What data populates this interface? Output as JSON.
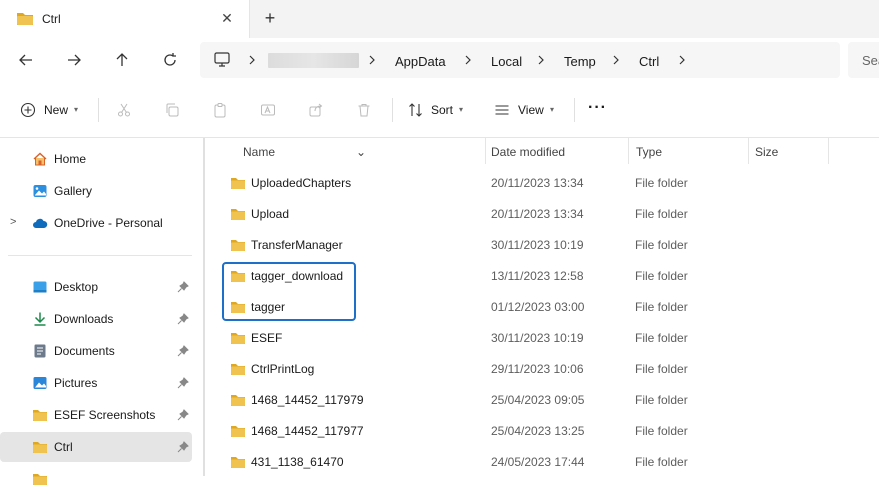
{
  "tab": {
    "title": "Ctrl",
    "close": "✕",
    "new_tab": "+"
  },
  "address": {
    "crumbs": [
      "AppData",
      "Local",
      "Temp",
      "Ctrl"
    ],
    "search_placeholder": "Sea"
  },
  "toolbar": {
    "new_label": "New",
    "sort_label": "Sort",
    "view_label": "View",
    "more_label": "···"
  },
  "sidebar": {
    "top_items": [
      {
        "label": "Home",
        "icon": "home-icon"
      },
      {
        "label": "Gallery",
        "icon": "gallery-icon"
      },
      {
        "label": "OneDrive - Personal",
        "icon": "cloud-icon"
      }
    ],
    "quick_access": [
      {
        "label": "Desktop",
        "icon": "desktop-icon"
      },
      {
        "label": "Downloads",
        "icon": "download-icon"
      },
      {
        "label": "Documents",
        "icon": "documents-icon"
      },
      {
        "label": "Pictures",
        "icon": "pictures-icon"
      },
      {
        "label": "ESEF Screenshots",
        "icon": "folder-icon"
      },
      {
        "label": "Ctrl",
        "icon": "folder-icon"
      }
    ]
  },
  "columns": {
    "name": "Name",
    "date": "Date modified",
    "type": "Type",
    "size": "Size"
  },
  "files": [
    {
      "name": "UploadedChapters",
      "date": "20/11/2023 13:34",
      "type": "File folder"
    },
    {
      "name": "Upload",
      "date": "20/11/2023 13:34",
      "type": "File folder"
    },
    {
      "name": "TransferManager",
      "date": "30/11/2023 10:19",
      "type": "File folder"
    },
    {
      "name": "tagger_download",
      "date": "13/11/2023 12:58",
      "type": "File folder"
    },
    {
      "name": "tagger",
      "date": "01/12/2023 03:00",
      "type": "File folder"
    },
    {
      "name": "ESEF",
      "date": "30/11/2023 10:19",
      "type": "File folder"
    },
    {
      "name": "CtrlPrintLog",
      "date": "29/11/2023 10:06",
      "type": "File folder"
    },
    {
      "name": "1468_14452_117979",
      "date": "25/04/2023 09:05",
      "type": "File folder"
    },
    {
      "name": "1468_14452_117977",
      "date": "25/04/2023 13:25",
      "type": "File folder"
    },
    {
      "name": "431_1138_61470",
      "date": "24/05/2023 17:44",
      "type": "File folder"
    }
  ],
  "colors": {
    "accent": "#1e6fc7",
    "folder": "#f0c350",
    "folder_dark": "#e0a820"
  }
}
